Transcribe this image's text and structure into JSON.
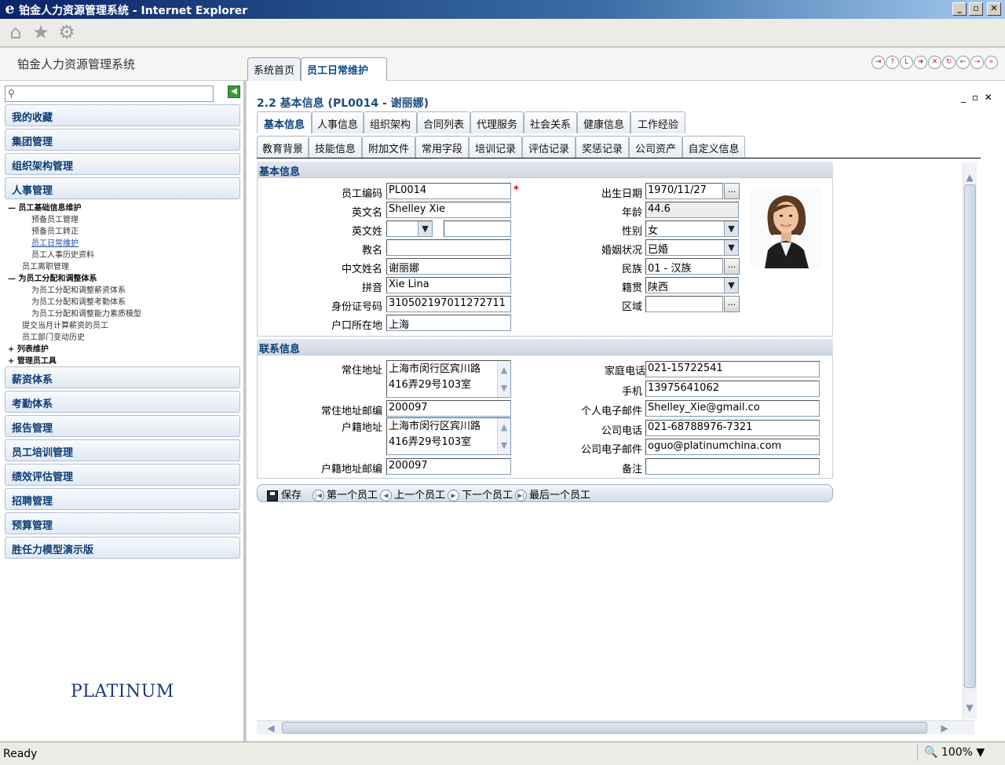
{
  "window": {
    "title": "铂金人力资源管理系统 - Internet Explorer",
    "ie_icon": "e",
    "minimize": "_",
    "restore": "▫",
    "close": "✕"
  },
  "app": {
    "title": "铂金人力资源管理系统"
  },
  "top_tabs": [
    {
      "label": "系统首页"
    },
    {
      "label": "员工日常维护"
    }
  ],
  "sidebar": {
    "search_placeholder": "",
    "menus": [
      "我的收藏",
      "集团管理",
      "组织架构管理",
      "人事管理"
    ],
    "tree": [
      {
        "text": "— 员工基础信息维护",
        "style": "bold"
      },
      {
        "text": "预备员工管理",
        "style": ""
      },
      {
        "text": "预备员工转正",
        "style": ""
      },
      {
        "text": "员工日常维护",
        "style": "link"
      },
      {
        "text": "员工人事历史资料",
        "style": ""
      },
      {
        "text": "员工离职管理",
        "style": ""
      },
      {
        "text": "— 为员工分配和调整体系",
        "style": "bold"
      },
      {
        "text": "为员工分配和调整薪资体系",
        "style": ""
      },
      {
        "text": "为员工分配和调整考勤体系",
        "style": ""
      },
      {
        "text": "为员工分配和调整能力素质模型",
        "style": ""
      },
      {
        "text": "提交当月计算薪资的员工",
        "style": ""
      },
      {
        "text": "员工部门变动历史",
        "style": ""
      },
      {
        "text": "+ 列表维护",
        "style": "bold"
      },
      {
        "text": "+ 管理员工具",
        "style": "bold"
      }
    ],
    "menus_bottom": [
      "薪资体系",
      "考勤体系",
      "报告管理",
      "员工培训管理",
      "绩效评估管理",
      "招聘管理",
      "预算管理",
      "胜任力模型演示版"
    ],
    "logo_text": "PLATINUM"
  },
  "main": {
    "page_title": "2.2 基本信息 (PL0014 - 谢丽娜)",
    "tabs_row1": [
      "基本信息",
      "人事信息",
      "组织架构",
      "合同列表",
      "代理服务",
      "社会关系",
      "健康信息",
      "工作经验"
    ],
    "tabs_row2": [
      "教育背景",
      "技能信息",
      "附加文件",
      "常用字段",
      "培训记录",
      "评估记录",
      "奖惩记录",
      "公司资产",
      "自定义信息"
    ],
    "basic_section": "基本信息",
    "contact_section": "联系信息",
    "basic": {
      "emp_no_label": "员工编码",
      "emp_no": "PL0014",
      "en_name_label": "英文名",
      "en_name": "Shelley Xie",
      "en_surname_label": "英文姓",
      "en_surname": "",
      "church_name_label": "教名",
      "church_name": "",
      "cn_name_label": "中文姓名",
      "cn_name": "谢丽娜",
      "pinyin_label": "拼音",
      "pinyin": "Xie Lina",
      "id_no_label": "身份证号码",
      "id_no": "310502197011272711",
      "hukou_label": "户口所在地",
      "hukou": "上海",
      "birth_label": "出生日期",
      "birth": "1970/11/27",
      "age_label": "年龄",
      "age": "44.6",
      "gender_label": "性别",
      "gender": "女",
      "marital_label": "婚姻状况",
      "marital": "已婚",
      "ethnic_label": "民族",
      "ethnic": "01 - 汉族",
      "native_label": "籍贯",
      "native": "陕西",
      "region_label": "区域",
      "region": "",
      "required_mark": "*"
    },
    "contact": {
      "addr_label": "常住地址",
      "addr_line1": "上海市闵行区宾川路",
      "addr_line2": "416弄29号103室",
      "addr_zip_label": "常住地址邮编",
      "addr_zip": "200097",
      "reg_addr_label": "户籍地址",
      "reg_addr_line1": "上海市闵行区宾川路",
      "reg_addr_line2": "416弄29号103室",
      "reg_zip_label": "户籍地址邮编",
      "reg_zip": "200097",
      "home_phone_label": "家庭电话",
      "home_phone": "021-15722541",
      "mobile_label": "手机",
      "mobile": "13975641062",
      "email_label": "个人电子邮件",
      "email": "Shelley_Xie@gmail.co",
      "office_phone_label": "公司电话",
      "office_phone": "021-68788976-7321",
      "office_email_label": "公司电子邮件",
      "office_email": "oguo@platinumchina.com",
      "remark_label": "备注",
      "remark": ""
    },
    "actions": {
      "save": "保存",
      "first": "第一个员工",
      "prev": "上一个员工",
      "next": "下一个员工",
      "last": "最后一个员工"
    }
  },
  "status": {
    "text": "Ready",
    "zoom": "100%"
  }
}
